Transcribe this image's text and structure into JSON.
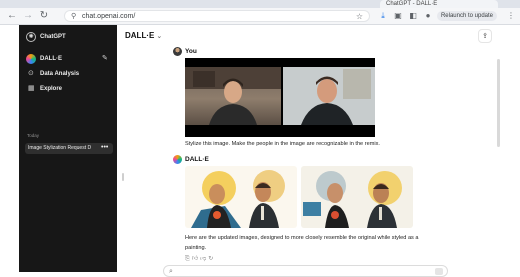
{
  "browser": {
    "tab_title": "ChatGPT - DALL·E",
    "url": "chat.openai.com/",
    "relaunch_label": "Relaunch to update"
  },
  "sidebar": {
    "brand": "ChatGPT",
    "items": [
      {
        "label": "DALL·E"
      },
      {
        "label": "Data Analysis"
      },
      {
        "label": "Explore"
      }
    ],
    "section_label": "Today",
    "chat_title": "Image Stylization Request D"
  },
  "main": {
    "model_name": "DALL·E",
    "messages": [
      {
        "author": "You",
        "text": "Stylize this image. Make the people in the image are recognizable in the remix."
      },
      {
        "author": "DALL·E",
        "text": "Here are the updated images, designed to more closely resemble the original while styled as a painting."
      }
    ]
  },
  "icons": {
    "back": "arrow-left-icon",
    "forward": "arrow-right-icon",
    "reload": "reload-icon",
    "bookmark": "star-icon",
    "edit": "new-chat-icon",
    "share": "share-icon",
    "more": "ellipsis-icon"
  },
  "colors": {
    "sidebar_bg": "#171717",
    "chat_item_bg": "#2f2f2f",
    "main_bg": "#ffffff"
  }
}
